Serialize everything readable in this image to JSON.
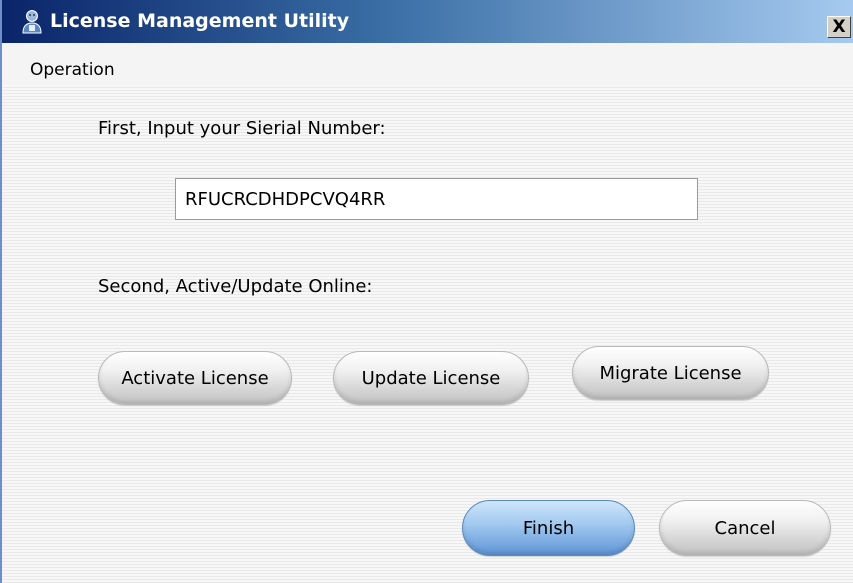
{
  "window": {
    "title": "License Management Utility",
    "close_label": "X"
  },
  "menu": {
    "items": [
      {
        "label": "Operation"
      }
    ]
  },
  "form": {
    "step1_label": "First, Input your Sierial Number:",
    "serial_value": "RFUCRCDHDPCVQ4RR",
    "step2_label": "Second, Active/Update Online:"
  },
  "buttons": {
    "activate": "Activate License",
    "update": "Update License",
    "migrate": "Migrate License",
    "finish": "Finish",
    "cancel": "Cancel"
  },
  "colors": {
    "titlebar_start": "#0a246a",
    "titlebar_end": "#a6caf0",
    "finish_button": "#76a7e0",
    "pill_button": "#d3d3d3"
  },
  "icons": {
    "app": "person-key-icon",
    "close": "close-icon"
  }
}
